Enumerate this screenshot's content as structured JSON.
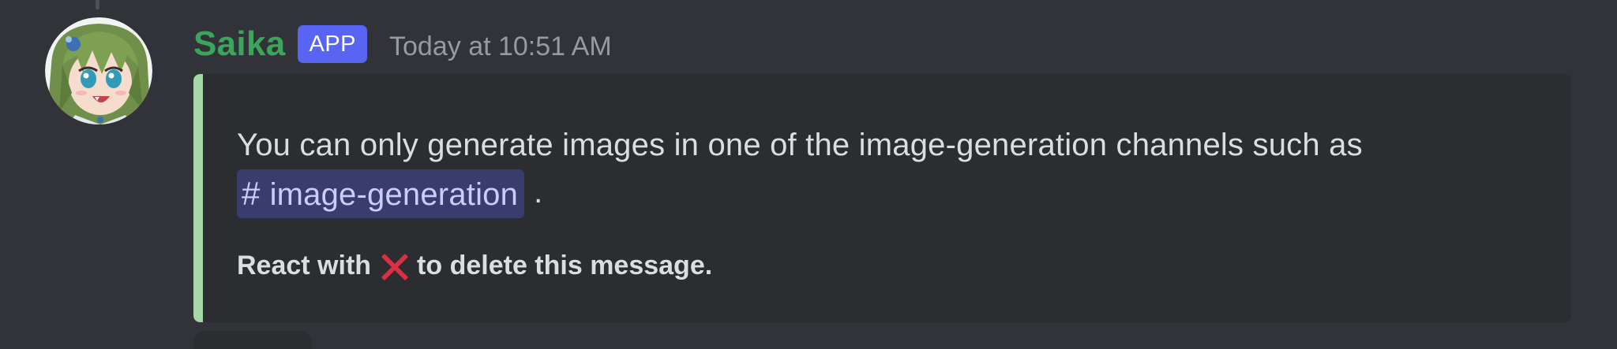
{
  "message": {
    "author": "Saika",
    "badge": "APP",
    "timestamp": "Today at 10:51 AM",
    "avatar_icon": "anime-character-avatar"
  },
  "embed": {
    "accent_color": "#a5d6a7",
    "description_text": "You can only generate images in one of the image-generation channels such as",
    "channel_mention": {
      "icon": "#",
      "name": "image-generation"
    },
    "description_suffix": ".",
    "footer": {
      "prefix": "React with",
      "emoji": "cross-mark-emoji",
      "suffix": "to delete this message."
    }
  },
  "colors": {
    "background": "#313338",
    "embed_background": "#2b2d31",
    "username": "#3ba55c",
    "badge": "#5865f2",
    "mention_background": "#3c4270",
    "mention_text": "#c9cdfb"
  }
}
